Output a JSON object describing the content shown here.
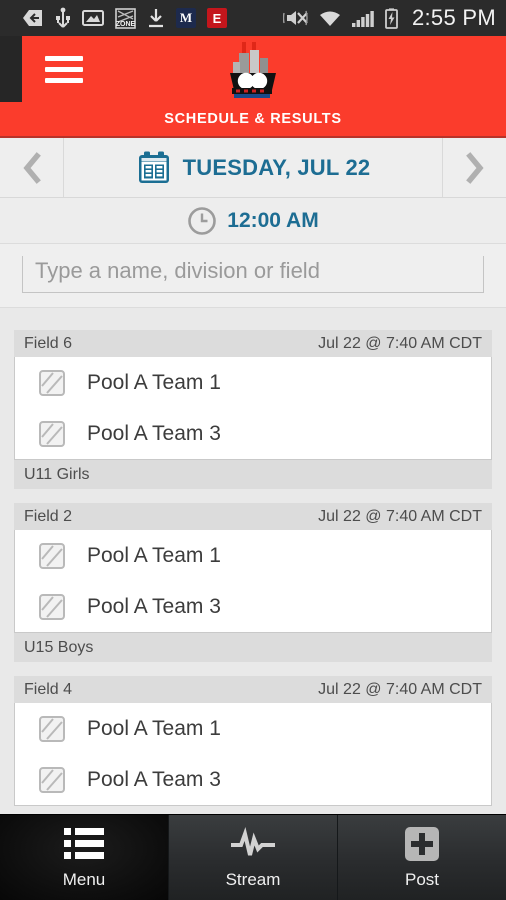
{
  "statusbar": {
    "time": "2:55 PM",
    "icons": [
      {
        "name": "back-arrow-icon",
        "label": "back"
      },
      {
        "name": "usb-icon",
        "label": "usb"
      },
      {
        "name": "screenshot-icon",
        "label": "screenshot"
      },
      {
        "name": "zone-app-icon",
        "label": "ZONE"
      },
      {
        "name": "download-icon",
        "label": "download"
      },
      {
        "name": "m-app-icon",
        "label": "M"
      },
      {
        "name": "e-app-icon",
        "label": "E"
      }
    ],
    "right_icons": [
      {
        "name": "mute-icon",
        "label": "silent"
      },
      {
        "name": "wifi-icon",
        "label": "wifi"
      },
      {
        "name": "signal-icon",
        "label": "signal"
      },
      {
        "name": "battery-charging-icon",
        "label": "battery"
      }
    ]
  },
  "header": {
    "menu_label": "Menu",
    "logo_name": "team-logo-icon",
    "title": "SCHEDULE & RESULTS"
  },
  "datebar": {
    "prev_label": "Previous day",
    "next_label": "Next day",
    "date": "TUESDAY, JUL 22",
    "calendar_icon": "calendar-icon"
  },
  "timebar": {
    "clock_icon": "clock-icon",
    "time": "12:00 AM"
  },
  "search": {
    "placeholder": "Type a name, division or field",
    "value": ""
  },
  "games": [
    {
      "field": "Field 6",
      "when": "Jul 22 @ 7:40 AM CDT",
      "teams": [
        "Pool A Team 1",
        "Pool A Team 3"
      ],
      "division": "U11 Girls"
    },
    {
      "field": "Field 2",
      "when": "Jul 22 @ 7:40 AM CDT",
      "teams": [
        "Pool A Team 1",
        "Pool A Team 3"
      ],
      "division": "U15 Boys"
    },
    {
      "field": "Field 4",
      "when": "Jul 22 @ 7:40 AM CDT",
      "teams": [
        "Pool A Team 1",
        "Pool A Team 3"
      ],
      "division": ""
    }
  ],
  "bottomnav": [
    {
      "label": "Menu",
      "icon": "list-icon",
      "active": true
    },
    {
      "label": "Stream",
      "icon": "pulse-icon",
      "active": false
    },
    {
      "label": "Post",
      "icon": "plus-square-icon",
      "active": false
    }
  ],
  "colors": {
    "brand_red": "#fb3c2c",
    "accent_teal": "#1d6d93",
    "page_bg": "#e9e9e9",
    "statusbar_bg": "#2b2b2b"
  }
}
